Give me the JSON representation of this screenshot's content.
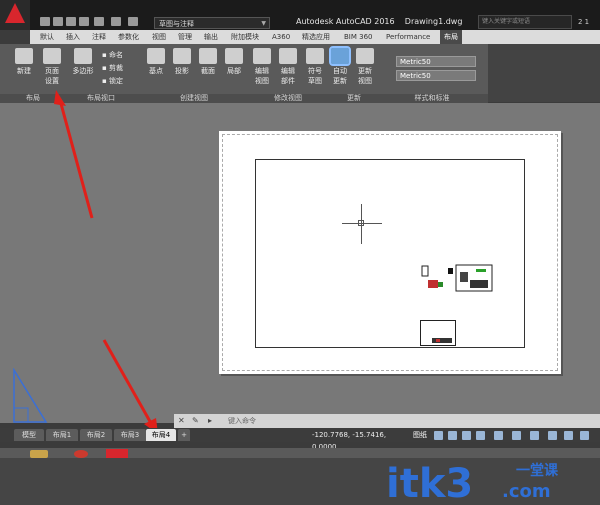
{
  "titlebar": {
    "workspace": "草图与注释",
    "app_name": "Autodesk AutoCAD 2016",
    "document": "Drawing1.dwg",
    "search_placeholder": "键入关键字或短语",
    "help_number": "2 1"
  },
  "ribbon_tabs": [
    "默认",
    "插入",
    "注释",
    "参数化",
    "视图",
    "管理",
    "输出",
    "附加模块",
    "A360",
    "精选应用",
    "BIM 360",
    "Performance",
    "布局"
  ],
  "active_ribbon_tab": "布局",
  "ribbon": {
    "new_label": "新建",
    "page_setup_label": "页面\n设置",
    "polygon_label": "多边形",
    "clip_label": "剪裁",
    "lock_label": "锁定",
    "name_label": "命名",
    "base_label": "基点",
    "projected_label": "投影",
    "section_label": "截面",
    "detail_label": "局部",
    "edit_view_label": "编辑\n视图",
    "edit_component_label": "编辑\n部件",
    "symbol_sketch_label": "符号\n草图",
    "auto_update_label": "自动\n更新",
    "update_view_label": "更新\n视图",
    "style_1": "Metric50",
    "style_2": "Metric50",
    "panels": [
      "布局",
      "布局视口",
      "创建视图",
      "修改视图",
      "更新",
      "样式和标准"
    ]
  },
  "command_line": {
    "placeholder": "键入命令"
  },
  "layout_tabs": [
    "模型",
    "布局1",
    "布局2",
    "布局3",
    "布局4"
  ],
  "active_layout_tab": "布局4",
  "add_tab": "+",
  "status": {
    "coordinates": "-120.7768, -15.7416, 0.0000",
    "space": "图纸"
  },
  "watermark": {
    "text": "itk3",
    "suffix": ".com",
    "tagline": "一堂课"
  },
  "colors": {
    "accent_red": "#d8262d",
    "watermark_blue": "#2f6fd6"
  }
}
